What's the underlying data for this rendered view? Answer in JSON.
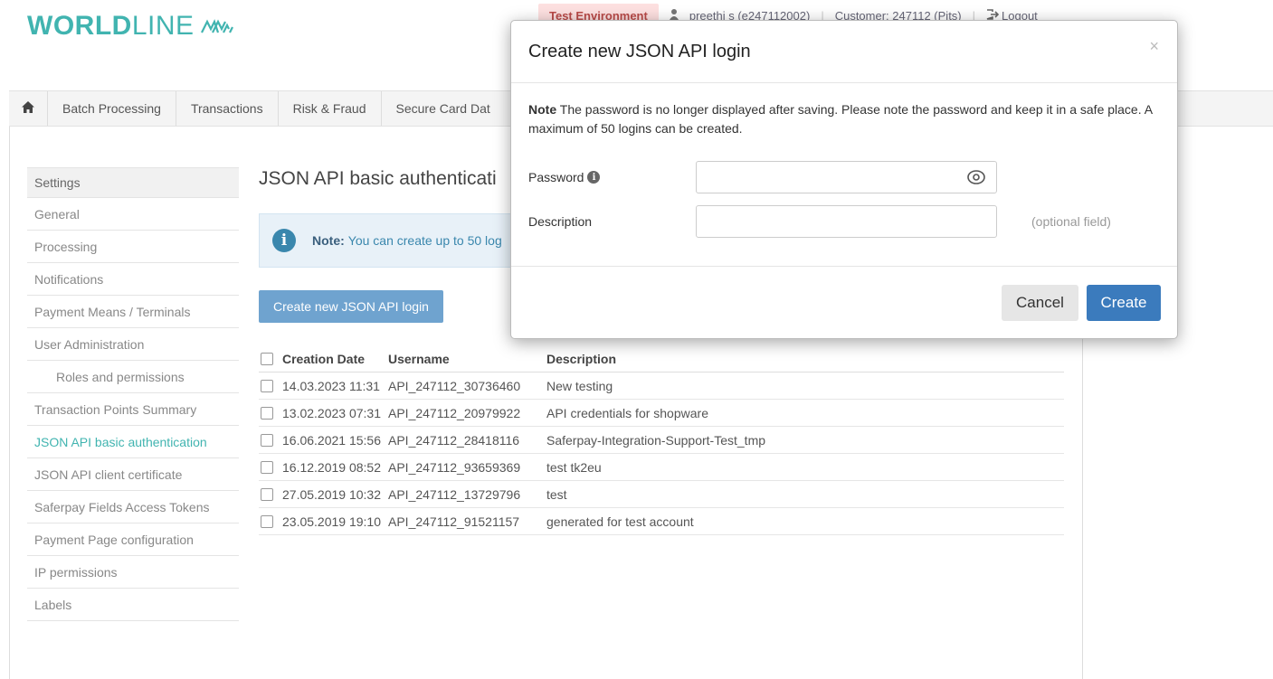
{
  "brand": {
    "logo_bold": "WORLD",
    "logo_light": "LINE",
    "color": "#41b4b0"
  },
  "topbar": {
    "environment": "Test Environment",
    "user": "preethi s (e247112002)",
    "customer": "Customer: 247112 (Pits)",
    "logout": "Logout"
  },
  "nav": {
    "items": [
      "Batch Processing",
      "Transactions",
      "Risk & Fraud",
      "Secure Card Dat"
    ]
  },
  "sidebar": {
    "heading": "Settings",
    "items": [
      "General",
      "Processing",
      "Notifications",
      "Payment Means / Terminals",
      "User Administration",
      "Roles and permissions",
      "Transaction Points Summary",
      "JSON API basic authentication",
      "JSON API client certificate",
      "Saferpay Fields Access Tokens",
      "Payment Page configuration",
      "IP permissions",
      "Labels"
    ]
  },
  "main": {
    "title": "JSON API basic authenticati",
    "info_note_bold": "Note:",
    "info_note_text": "You can create up to 50 log",
    "create_button": "Create new JSON API login"
  },
  "table": {
    "headers": [
      "Creation Date",
      "Username",
      "Description"
    ],
    "rows": [
      [
        "14.03.2023 11:31",
        "API_247112_30736460",
        "New testing"
      ],
      [
        "13.02.2023 07:31",
        "API_247112_20979922",
        "API credentials for shopware"
      ],
      [
        "16.06.2021 15:56",
        "API_247112_28418116",
        "Saferpay-Integration-Support-Test_tmp"
      ],
      [
        "16.12.2019 08:52",
        "API_247112_93659369",
        "test tk2eu"
      ],
      [
        "27.05.2019 10:32",
        "API_247112_13729796",
        "test"
      ],
      [
        "23.05.2019 19:10",
        "API_247112_91521157",
        "generated for test account"
      ]
    ]
  },
  "modal": {
    "title": "Create new JSON API login",
    "close": "×",
    "note_bold": "Note",
    "note_text": "The password is no longer displayed after saving. Please note the password and keep it in a safe place. A maximum of 50 logins can be created.",
    "password_label": "Password",
    "password_value": "",
    "description_label": "Description",
    "description_value": "",
    "optional_hint": "(optional field)",
    "cancel": "Cancel",
    "create": "Create"
  },
  "icons": {
    "home": "home-icon",
    "info": "info-icon",
    "eye": "eye-icon",
    "user": "user-icon",
    "logout": "logout-icon"
  }
}
